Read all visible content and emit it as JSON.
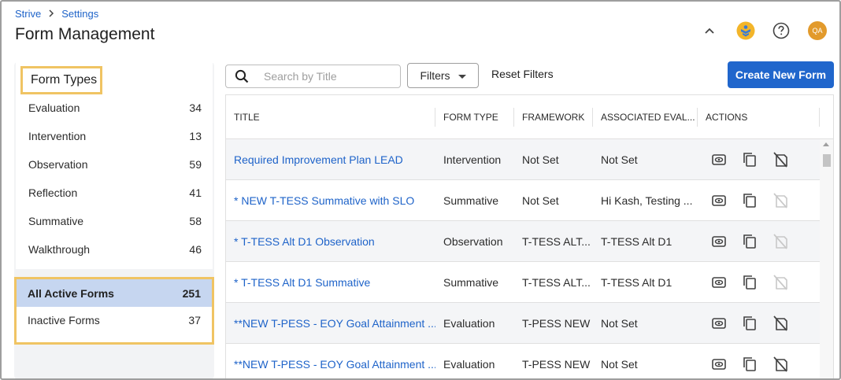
{
  "breadcrumb": {
    "root": "Strive",
    "current": "Settings"
  },
  "page_title": "Form Management",
  "header_icons": [
    "chevron-up-icon",
    "app-logo-icon",
    "help-icon",
    "user-avatar"
  ],
  "user_initials": "QA",
  "form_types": {
    "heading": "Form Types",
    "items": [
      {
        "label": "Evaluation",
        "count": "34"
      },
      {
        "label": "Intervention",
        "count": "13"
      },
      {
        "label": "Observation",
        "count": "59"
      },
      {
        "label": "Reflection",
        "count": "41"
      },
      {
        "label": "Summative",
        "count": "58"
      },
      {
        "label": "Walkthrough",
        "count": "46"
      }
    ]
  },
  "status_filters": [
    {
      "label": "All Active Forms",
      "count": "251",
      "selected": true
    },
    {
      "label": "Inactive Forms",
      "count": "37",
      "selected": false
    }
  ],
  "search": {
    "placeholder": "Search by Title",
    "value": ""
  },
  "toolbar": {
    "filters_label": "Filters",
    "reset_label": "Reset Filters",
    "create_label": "Create New Form"
  },
  "table": {
    "headers": [
      "TITLE",
      "FORM TYPE",
      "FRAMEWORK",
      "ASSOCIATED EVAL...",
      "ACTIONS"
    ],
    "rows": [
      {
        "title": "Required Improvement Plan LEAD",
        "form_type": "Intervention",
        "framework": "Not Set",
        "associated": "Not Set",
        "delete_enabled": true
      },
      {
        "title": "* NEW T-TESS Summative with SLO",
        "form_type": "Summative",
        "framework": "Not Set",
        "associated": "Hi Kash, Testing ...",
        "delete_enabled": false
      },
      {
        "title": "* T-TESS Alt D1 Observation",
        "form_type": "Observation",
        "framework": "T-TESS ALT...",
        "associated": "T-TESS Alt D1",
        "delete_enabled": false
      },
      {
        "title": "* T-TESS Alt D1 Summative",
        "form_type": "Summative",
        "framework": "T-TESS ALT...",
        "associated": "T-TESS Alt D1",
        "delete_enabled": false
      },
      {
        "title": "**NEW T-PESS - EOY Goal Attainment ...",
        "form_type": "Evaluation",
        "framework": "T-PESS NEW",
        "associated": "Not Set",
        "delete_enabled": true
      },
      {
        "title": "**NEW T-PESS - EOY Goal Attainment ...",
        "form_type": "Evaluation",
        "framework": "T-PESS NEW",
        "associated": "Not Set",
        "delete_enabled": true
      }
    ]
  },
  "colors": {
    "link": "#1e63c9",
    "primary_button": "#2066cc",
    "highlight_border": "#f0c463",
    "selected_row": "#c6d6f0"
  }
}
